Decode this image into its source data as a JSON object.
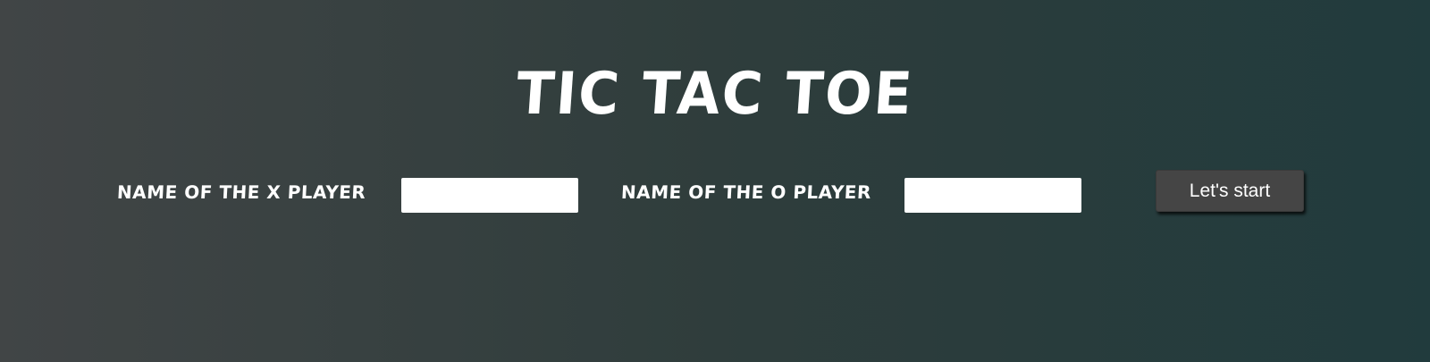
{
  "title": "TIC TAC TOE",
  "form": {
    "x_player_label": "NAME OF THE X PLAYER",
    "x_player_value": "",
    "o_player_label": "NAME OF THE O PLAYER",
    "o_player_value": "",
    "start_button_label": "Let's start"
  },
  "colors": {
    "background_left": "#414546",
    "background_right": "#213b3d",
    "text": "#ffffff",
    "button_background": "#454545"
  }
}
